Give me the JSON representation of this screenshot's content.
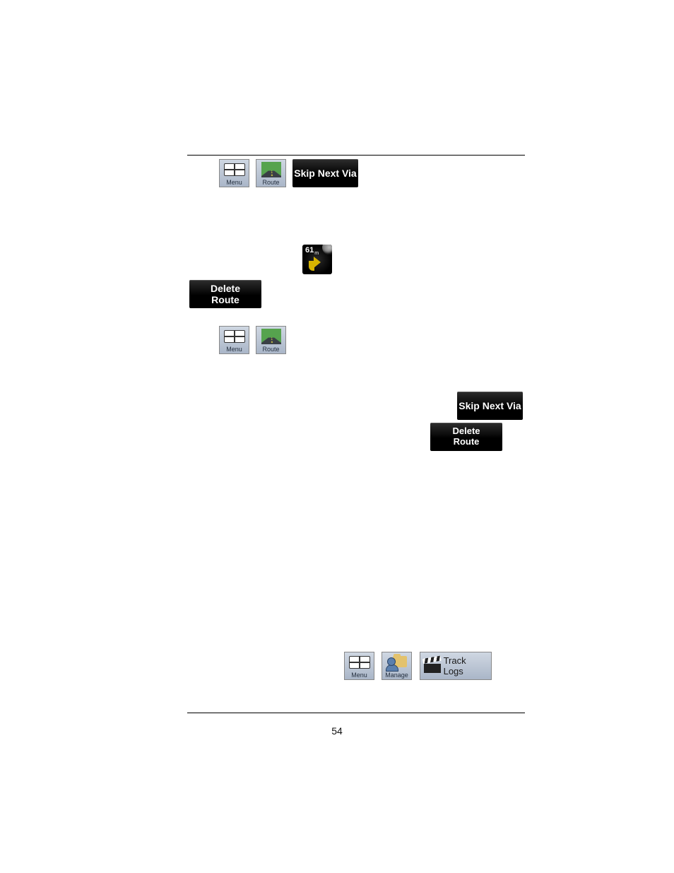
{
  "buttons": {
    "menu_label": "Menu",
    "route_label": "Route",
    "manage_label": "Manage",
    "skip_next_via": "Skip Next Via",
    "delete_route": "Delete\nRoute",
    "track_logs": "Track Logs"
  },
  "turn_preview": {
    "distance_value": "61",
    "distance_unit": "m"
  },
  "footer": {
    "page_number": "54"
  }
}
